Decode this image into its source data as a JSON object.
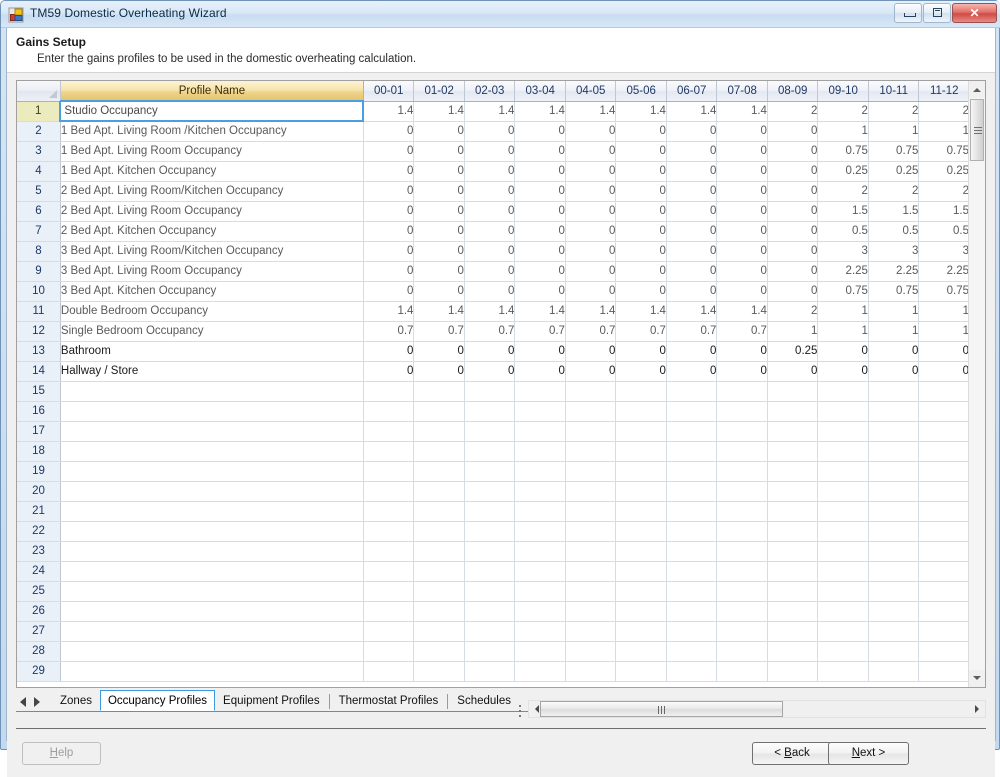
{
  "window": {
    "title": "TM59 Domestic Overheating Wizard",
    "icon": "app-icon",
    "buttons": {
      "minimize": "minimize-icon",
      "maximize": "maximize-icon",
      "close": "✕"
    }
  },
  "page": {
    "title": "Gains Setup",
    "subtitle": "Enter the gains profiles to be used in the domestic overheating calculation."
  },
  "grid": {
    "corner_label": "",
    "name_column_header": "Profile Name",
    "hour_columns": [
      "00-01",
      "01-02",
      "02-03",
      "03-04",
      "04-05",
      "05-06",
      "06-07",
      "07-08",
      "08-09",
      "09-10",
      "10-11",
      "11-12"
    ],
    "rows": [
      {
        "num": "1",
        "name": "Studio Occupancy",
        "dark": false,
        "selected": true,
        "current": true,
        "values": [
          "1.4",
          "1.4",
          "1.4",
          "1.4",
          "1.4",
          "1.4",
          "1.4",
          "1.4",
          "2",
          "2",
          "2",
          "2"
        ]
      },
      {
        "num": "2",
        "name": "1 Bed Apt. Living Room /Kitchen Occupancy",
        "dark": false,
        "selected": false,
        "current": false,
        "values": [
          "0",
          "0",
          "0",
          "0",
          "0",
          "0",
          "0",
          "0",
          "0",
          "1",
          "1",
          "1"
        ]
      },
      {
        "num": "3",
        "name": "1 Bed Apt. Living Room Occupancy",
        "dark": false,
        "selected": false,
        "current": false,
        "values": [
          "0",
          "0",
          "0",
          "0",
          "0",
          "0",
          "0",
          "0",
          "0",
          "0.75",
          "0.75",
          "0.75"
        ]
      },
      {
        "num": "4",
        "name": "1 Bed Apt. Kitchen Occupancy",
        "dark": false,
        "selected": false,
        "current": false,
        "values": [
          "0",
          "0",
          "0",
          "0",
          "0",
          "0",
          "0",
          "0",
          "0",
          "0.25",
          "0.25",
          "0.25"
        ]
      },
      {
        "num": "5",
        "name": "2 Bed Apt. Living Room/Kitchen Occupancy",
        "dark": false,
        "selected": false,
        "current": false,
        "values": [
          "0",
          "0",
          "0",
          "0",
          "0",
          "0",
          "0",
          "0",
          "0",
          "2",
          "2",
          "2"
        ]
      },
      {
        "num": "6",
        "name": "2 Bed Apt. Living Room Occupancy",
        "dark": false,
        "selected": false,
        "current": false,
        "values": [
          "0",
          "0",
          "0",
          "0",
          "0",
          "0",
          "0",
          "0",
          "0",
          "1.5",
          "1.5",
          "1.5"
        ]
      },
      {
        "num": "7",
        "name": "2 Bed Apt. Kitchen Occupancy",
        "dark": false,
        "selected": false,
        "current": false,
        "values": [
          "0",
          "0",
          "0",
          "0",
          "0",
          "0",
          "0",
          "0",
          "0",
          "0.5",
          "0.5",
          "0.5"
        ]
      },
      {
        "num": "8",
        "name": "3 Bed Apt. Living Room/Kitchen Occupancy",
        "dark": false,
        "selected": false,
        "current": false,
        "values": [
          "0",
          "0",
          "0",
          "0",
          "0",
          "0",
          "0",
          "0",
          "0",
          "3",
          "3",
          "3"
        ]
      },
      {
        "num": "9",
        "name": "3 Bed Apt. Living Room Occupancy",
        "dark": false,
        "selected": false,
        "current": false,
        "values": [
          "0",
          "0",
          "0",
          "0",
          "0",
          "0",
          "0",
          "0",
          "0",
          "2.25",
          "2.25",
          "2.25"
        ]
      },
      {
        "num": "10",
        "name": "3 Bed Apt. Kitchen Occupancy",
        "dark": false,
        "selected": false,
        "current": false,
        "values": [
          "0",
          "0",
          "0",
          "0",
          "0",
          "0",
          "0",
          "0",
          "0",
          "0.75",
          "0.75",
          "0.75"
        ]
      },
      {
        "num": "11",
        "name": "Double Bedroom Occupancy",
        "dark": false,
        "selected": false,
        "current": false,
        "values": [
          "1.4",
          "1.4",
          "1.4",
          "1.4",
          "1.4",
          "1.4",
          "1.4",
          "1.4",
          "2",
          "1",
          "1",
          "1"
        ]
      },
      {
        "num": "12",
        "name": "Single Bedroom Occupancy",
        "dark": false,
        "selected": false,
        "current": false,
        "values": [
          "0.7",
          "0.7",
          "0.7",
          "0.7",
          "0.7",
          "0.7",
          "0.7",
          "0.7",
          "1",
          "1",
          "1",
          "1"
        ]
      },
      {
        "num": "13",
        "name": "Bathroom",
        "dark": true,
        "selected": false,
        "current": false,
        "values": [
          "0",
          "0",
          "0",
          "0",
          "0",
          "0",
          "0",
          "0",
          "0.25",
          "0",
          "0",
          "0"
        ]
      },
      {
        "num": "14",
        "name": "Hallway / Store",
        "dark": true,
        "selected": false,
        "current": false,
        "values": [
          "0",
          "0",
          "0",
          "0",
          "0",
          "0",
          "0",
          "0",
          "0",
          "0",
          "0",
          "0"
        ]
      },
      {
        "num": "15",
        "name": "",
        "dark": false,
        "selected": false,
        "current": false,
        "values": [
          "",
          "",
          "",
          "",
          "",
          "",
          "",
          "",
          "",
          "",
          "",
          ""
        ]
      },
      {
        "num": "16",
        "name": "",
        "dark": false,
        "selected": false,
        "current": false,
        "values": [
          "",
          "",
          "",
          "",
          "",
          "",
          "",
          "",
          "",
          "",
          "",
          ""
        ]
      },
      {
        "num": "17",
        "name": "",
        "dark": false,
        "selected": false,
        "current": false,
        "values": [
          "",
          "",
          "",
          "",
          "",
          "",
          "",
          "",
          "",
          "",
          "",
          ""
        ]
      },
      {
        "num": "18",
        "name": "",
        "dark": false,
        "selected": false,
        "current": false,
        "values": [
          "",
          "",
          "",
          "",
          "",
          "",
          "",
          "",
          "",
          "",
          "",
          ""
        ]
      },
      {
        "num": "19",
        "name": "",
        "dark": false,
        "selected": false,
        "current": false,
        "values": [
          "",
          "",
          "",
          "",
          "",
          "",
          "",
          "",
          "",
          "",
          "",
          ""
        ]
      },
      {
        "num": "20",
        "name": "",
        "dark": false,
        "selected": false,
        "current": false,
        "values": [
          "",
          "",
          "",
          "",
          "",
          "",
          "",
          "",
          "",
          "",
          "",
          ""
        ]
      },
      {
        "num": "21",
        "name": "",
        "dark": false,
        "selected": false,
        "current": false,
        "values": [
          "",
          "",
          "",
          "",
          "",
          "",
          "",
          "",
          "",
          "",
          "",
          ""
        ]
      },
      {
        "num": "22",
        "name": "",
        "dark": false,
        "selected": false,
        "current": false,
        "values": [
          "",
          "",
          "",
          "",
          "",
          "",
          "",
          "",
          "",
          "",
          "",
          ""
        ]
      },
      {
        "num": "23",
        "name": "",
        "dark": false,
        "selected": false,
        "current": false,
        "values": [
          "",
          "",
          "",
          "",
          "",
          "",
          "",
          "",
          "",
          "",
          "",
          ""
        ]
      },
      {
        "num": "24",
        "name": "",
        "dark": false,
        "selected": false,
        "current": false,
        "values": [
          "",
          "",
          "",
          "",
          "",
          "",
          "",
          "",
          "",
          "",
          "",
          ""
        ]
      },
      {
        "num": "25",
        "name": "",
        "dark": false,
        "selected": false,
        "current": false,
        "values": [
          "",
          "",
          "",
          "",
          "",
          "",
          "",
          "",
          "",
          "",
          "",
          ""
        ]
      },
      {
        "num": "26",
        "name": "",
        "dark": false,
        "selected": false,
        "current": false,
        "values": [
          "",
          "",
          "",
          "",
          "",
          "",
          "",
          "",
          "",
          "",
          "",
          ""
        ]
      },
      {
        "num": "27",
        "name": "",
        "dark": false,
        "selected": false,
        "current": false,
        "values": [
          "",
          "",
          "",
          "",
          "",
          "",
          "",
          "",
          "",
          "",
          "",
          ""
        ]
      },
      {
        "num": "28",
        "name": "",
        "dark": false,
        "selected": false,
        "current": false,
        "values": [
          "",
          "",
          "",
          "",
          "",
          "",
          "",
          "",
          "",
          "",
          "",
          ""
        ]
      },
      {
        "num": "29",
        "name": "",
        "dark": false,
        "selected": false,
        "current": false,
        "values": [
          "",
          "",
          "",
          "",
          "",
          "",
          "",
          "",
          "",
          "",
          "",
          ""
        ]
      }
    ]
  },
  "tabs": [
    {
      "label": "Zones",
      "active": false,
      "sep_after": false
    },
    {
      "label": "Occupancy Profiles",
      "active": true,
      "sep_after": false
    },
    {
      "label": "Equipment Profiles",
      "active": false,
      "sep_after": true
    },
    {
      "label": "Thermostat Profiles",
      "active": false,
      "sep_after": true
    },
    {
      "label": "Schedules",
      "active": false,
      "sep_after": false
    }
  ],
  "footer": {
    "help": "Help",
    "help_mnemonic": "H",
    "back": "< Back",
    "back_mnemonic": "B",
    "next": "Next >",
    "next_mnemonic": "N"
  },
  "colors": {
    "accent_blue": "#3d9ae0",
    "header_gold": "#e6c46c",
    "current_row": "#ecebbd",
    "close_red": "#cf4b44"
  }
}
